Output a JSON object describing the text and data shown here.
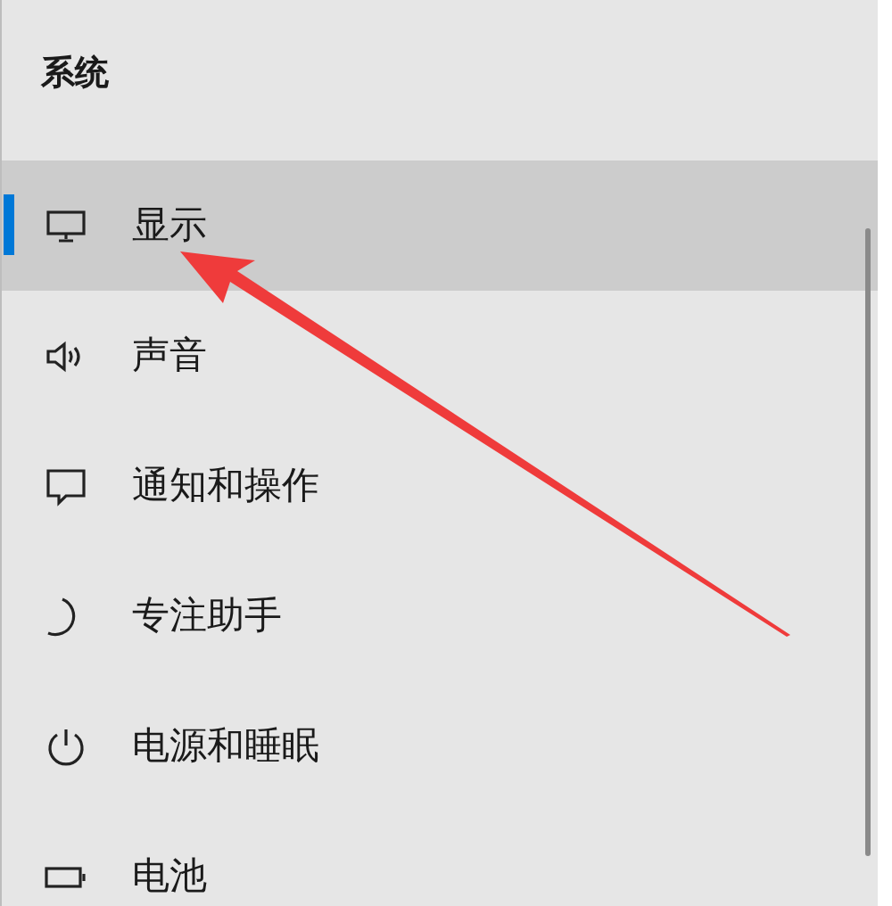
{
  "heading": "系统",
  "items": [
    {
      "kind": "display",
      "label": "显示",
      "selected": true
    },
    {
      "kind": "sound",
      "label": "声音",
      "selected": false
    },
    {
      "kind": "notifications",
      "label": "通知和操作",
      "selected": false
    },
    {
      "kind": "focus",
      "label": "专注助手",
      "selected": false
    },
    {
      "kind": "power",
      "label": "电源和睡眠",
      "selected": false
    },
    {
      "kind": "battery",
      "label": "电池",
      "selected": false
    }
  ]
}
